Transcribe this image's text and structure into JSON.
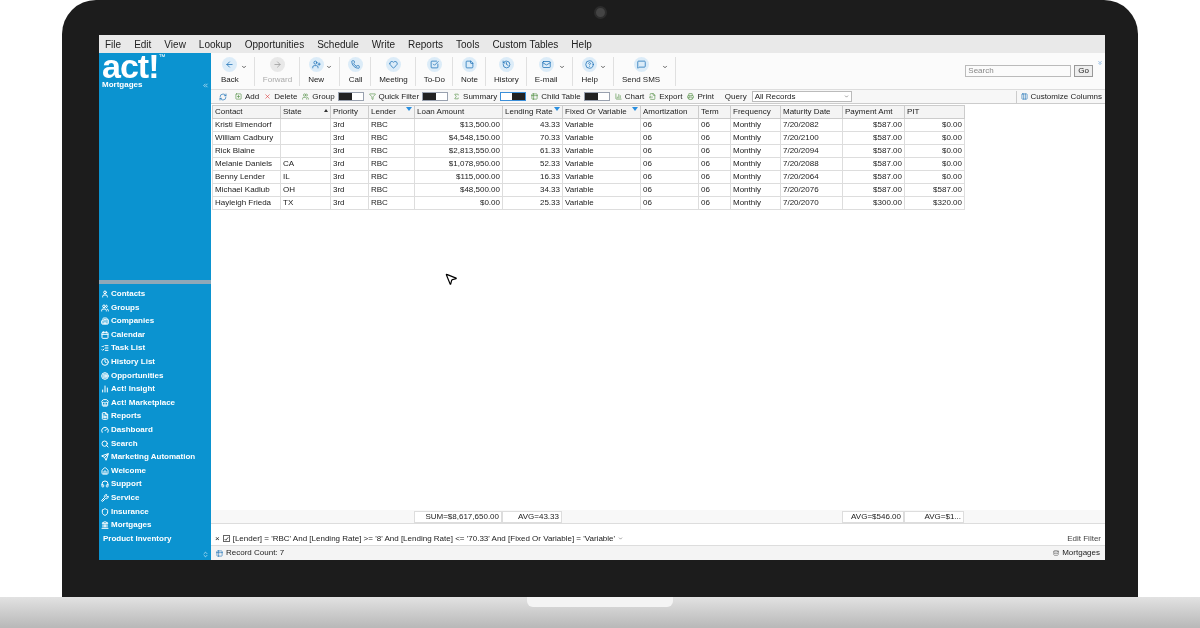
{
  "menu": [
    "File",
    "Edit",
    "View",
    "Lookup",
    "Opportunities",
    "Schedule",
    "Write",
    "Reports",
    "Tools",
    "Custom Tables",
    "Help"
  ],
  "logo": {
    "text": "act!",
    "mark": "™",
    "subtitle": "Mortgages"
  },
  "toolbar": [
    {
      "label": "Back",
      "disabled": false,
      "dropdown": true
    },
    {
      "label": "Forward",
      "disabled": true,
      "dropdown": false
    },
    {
      "label": "New",
      "disabled": false,
      "dropdown": true
    },
    {
      "label": "Call",
      "disabled": false,
      "dropdown": false
    },
    {
      "label": "Meeting",
      "disabled": false,
      "dropdown": false
    },
    {
      "label": "To-Do",
      "disabled": false,
      "dropdown": false
    },
    {
      "label": "Note",
      "disabled": false,
      "dropdown": false
    },
    {
      "label": "History",
      "disabled": false,
      "dropdown": false
    },
    {
      "label": "E-mail",
      "disabled": false,
      "dropdown": true
    },
    {
      "label": "Help",
      "disabled": false,
      "dropdown": true
    },
    {
      "label": "Send SMS",
      "disabled": false,
      "dropdown": true
    }
  ],
  "search": {
    "placeholder": "Search",
    "button": "Go"
  },
  "list_toolbar": [
    {
      "kind": "button",
      "label": "Add"
    },
    {
      "kind": "button",
      "label": "Delete"
    },
    {
      "kind": "toggle",
      "label": "Group",
      "on": false
    },
    {
      "kind": "toggle",
      "label": "Quick Filter",
      "on": false
    },
    {
      "kind": "toggle",
      "label": "Summary",
      "on": true
    },
    {
      "kind": "toggle",
      "label": "Child Table",
      "on": false
    },
    {
      "kind": "button",
      "label": "Chart"
    },
    {
      "kind": "button",
      "label": "Export"
    },
    {
      "kind": "button",
      "label": "Print"
    }
  ],
  "query": {
    "label": "Query",
    "value": "All Records"
  },
  "customize": "Customize Columns",
  "sidebar": {
    "items": [
      "Contacts",
      "Groups",
      "Companies",
      "Calendar",
      "Task List",
      "History List",
      "Opportunities",
      "Act! Insight",
      "Act! Marketplace",
      "Reports",
      "Dashboard",
      "Search",
      "Marketing Automation",
      "Welcome",
      "Support",
      "Service",
      "Insurance",
      "Mortgages"
    ],
    "footer": "Product Inventory"
  },
  "table": {
    "columns": [
      {
        "label": "Contact",
        "sorted": false,
        "filtered": false,
        "kind": "text"
      },
      {
        "label": "State",
        "sorted": true,
        "filtered": false,
        "kind": "text"
      },
      {
        "label": "Priority",
        "sorted": false,
        "filtered": false,
        "kind": "text"
      },
      {
        "label": "Lender",
        "sorted": false,
        "filtered": true,
        "kind": "text"
      },
      {
        "label": "Loan Amount",
        "sorted": false,
        "filtered": false,
        "kind": "number",
        "summary": "SUM=$8,617,650.00"
      },
      {
        "label": "Lending Rate",
        "sorted": false,
        "filtered": true,
        "kind": "number",
        "summary": "AVG=43.33"
      },
      {
        "label": "Fixed Or Variable",
        "sorted": false,
        "filtered": true,
        "kind": "text"
      },
      {
        "label": "Amortization",
        "sorted": false,
        "filtered": false,
        "kind": "text"
      },
      {
        "label": "Term",
        "sorted": false,
        "filtered": false,
        "kind": "text"
      },
      {
        "label": "Frequency",
        "sorted": false,
        "filtered": false,
        "kind": "text"
      },
      {
        "label": "Maturity Date",
        "sorted": false,
        "filtered": false,
        "kind": "text"
      },
      {
        "label": "Payment Amt",
        "sorted": false,
        "filtered": false,
        "kind": "number",
        "summary": "AVG=$546.00"
      },
      {
        "label": "PIT",
        "sorted": false,
        "filtered": false,
        "kind": "number",
        "summary": "AVG=$1..."
      }
    ],
    "rows": [
      [
        "Kristi Elmendorf",
        "",
        "3rd",
        "RBC",
        "$13,500.00",
        "43.33",
        "Variable",
        "06",
        "06",
        "Monthly",
        "7/20/2082",
        "$587.00",
        "$0.00"
      ],
      [
        "William Cadbury",
        "",
        "3rd",
        "RBC",
        "$4,548,150.00",
        "70.33",
        "Variable",
        "06",
        "06",
        "Monthly",
        "7/20/2100",
        "$587.00",
        "$0.00"
      ],
      [
        "Rick Blaine",
        "",
        "3rd",
        "RBC",
        "$2,813,550.00",
        "61.33",
        "Variable",
        "06",
        "06",
        "Monthly",
        "7/20/2094",
        "$587.00",
        "$0.00"
      ],
      [
        "Melanie Daniels",
        "CA",
        "3rd",
        "RBC",
        "$1,078,950.00",
        "52.33",
        "Variable",
        "06",
        "06",
        "Monthly",
        "7/20/2088",
        "$587.00",
        "$0.00"
      ],
      [
        "Benny Lender",
        "IL",
        "3rd",
        "RBC",
        "$115,000.00",
        "16.33",
        "Variable",
        "06",
        "06",
        "Monthly",
        "7/20/2064",
        "$587.00",
        "$0.00"
      ],
      [
        "Michael Kadlub",
        "OH",
        "3rd",
        "RBC",
        "$48,500.00",
        "34.33",
        "Variable",
        "06",
        "06",
        "Monthly",
        "7/20/2076",
        "$587.00",
        "$587.00"
      ],
      [
        "Hayleigh Frieda",
        "TX",
        "3rd",
        "RBC",
        "$0.00",
        "25.33",
        "Variable",
        "06",
        "06",
        "Monthly",
        "7/20/2070",
        "$300.00",
        "$320.00"
      ]
    ]
  },
  "filter": {
    "close": "×",
    "checked": true,
    "text": "[Lender] = 'RBC' And [Lending Rate] >= '8' And [Lending Rate] <= '70.33' And [Fixed Or Variable] = 'Variable'",
    "edit": "Edit Filter"
  },
  "status": {
    "record_count": "Record Count: 7",
    "database": "Mortgages"
  }
}
